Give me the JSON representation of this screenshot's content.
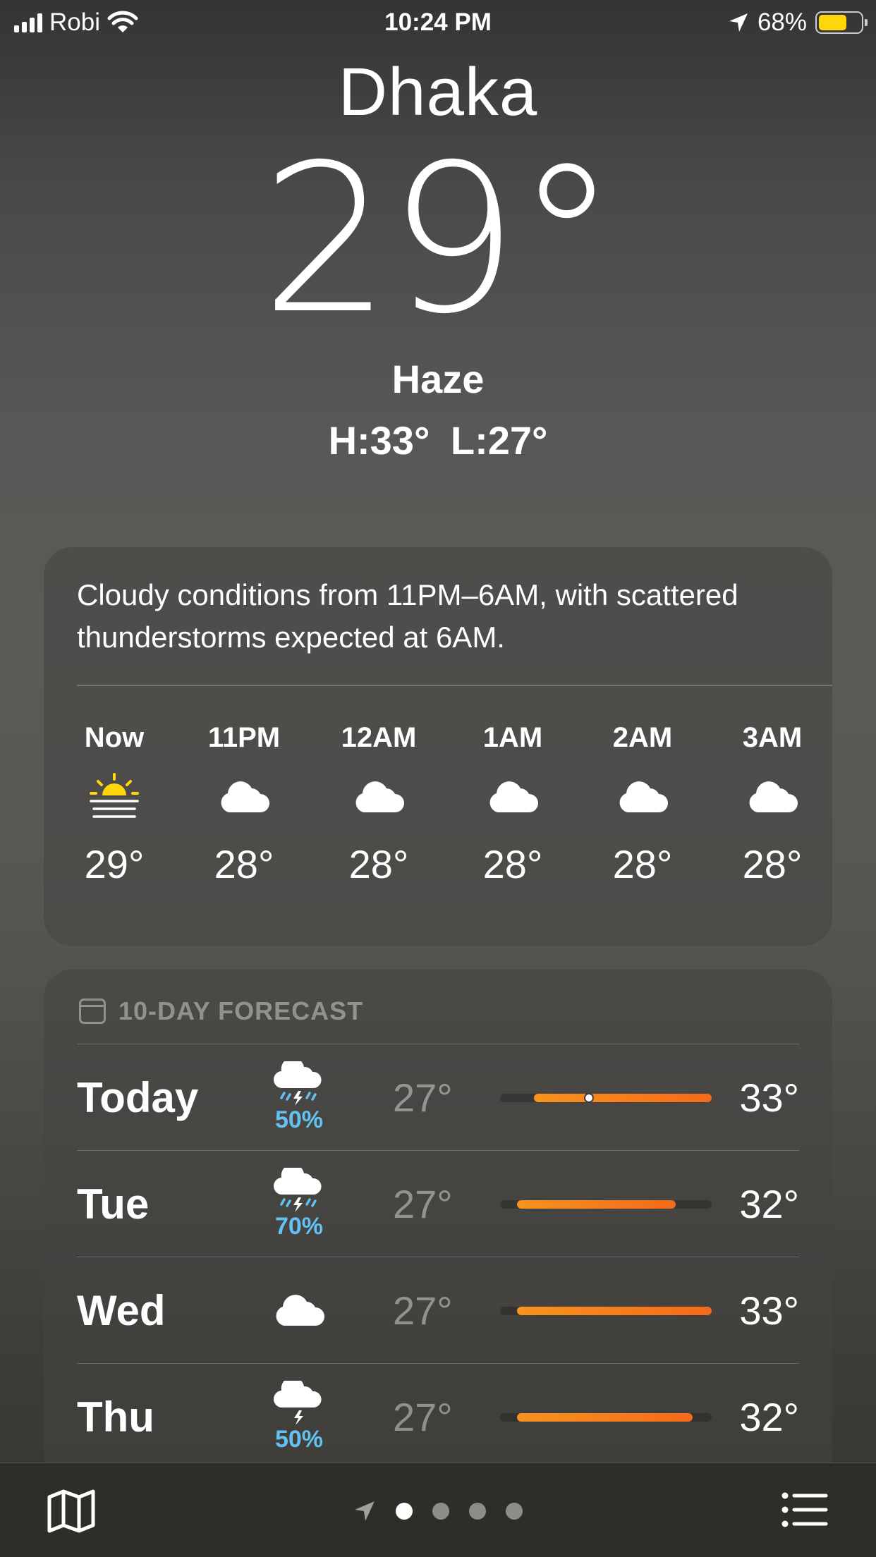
{
  "status_bar": {
    "carrier": "Robi",
    "time": "10:24 PM",
    "battery_percent": "68%",
    "battery_level": 0.68,
    "battery_color": "#ffd60a",
    "icons": [
      "signal-icon",
      "wifi-icon",
      "location-arrow-icon",
      "battery-icon"
    ]
  },
  "header": {
    "city": "Dhaka",
    "temperature": "29°",
    "condition": "Haze",
    "high_low": "H:33°  L:27°"
  },
  "hourly": {
    "summary": "Cloudy conditions from 11PM–6AM, with scattered thunderstorms expected at 6AM.",
    "items": [
      {
        "time": "Now",
        "icon": "sunset-haze-icon",
        "temp": "29°"
      },
      {
        "time": "11PM",
        "icon": "cloud-icon",
        "temp": "28°"
      },
      {
        "time": "12AM",
        "icon": "cloud-icon",
        "temp": "28°"
      },
      {
        "time": "1AM",
        "icon": "cloud-icon",
        "temp": "28°"
      },
      {
        "time": "2AM",
        "icon": "cloud-icon",
        "temp": "28°"
      },
      {
        "time": "3AM",
        "icon": "cloud-icon",
        "temp": "28°"
      }
    ]
  },
  "forecast": {
    "title": "10-DAY FORECAST",
    "range_min": 27,
    "range_max": 33,
    "days": [
      {
        "day": "Today",
        "icon": "thunderstorm-rain-icon",
        "precip": "50%",
        "low": "27°",
        "high": "33°",
        "bar_start": 0.16,
        "bar_end": 1.0,
        "current_marker": 0.42
      },
      {
        "day": "Tue",
        "icon": "thunderstorm-rain-icon",
        "precip": "70%",
        "low": "27°",
        "high": "32°",
        "bar_start": 0.08,
        "bar_end": 0.83
      },
      {
        "day": "Wed",
        "icon": "cloud-icon",
        "precip": "",
        "low": "27°",
        "high": "33°",
        "bar_start": 0.08,
        "bar_end": 1.0
      },
      {
        "day": "Thu",
        "icon": "thunderstorm-icon",
        "precip": "50%",
        "low": "27°",
        "high": "32°",
        "bar_start": 0.08,
        "bar_end": 0.91
      }
    ]
  },
  "toolbar": {
    "page_count": 4,
    "active_page": 0,
    "icons": [
      "map-icon",
      "location-arrow-icon",
      "list-icon"
    ]
  }
}
